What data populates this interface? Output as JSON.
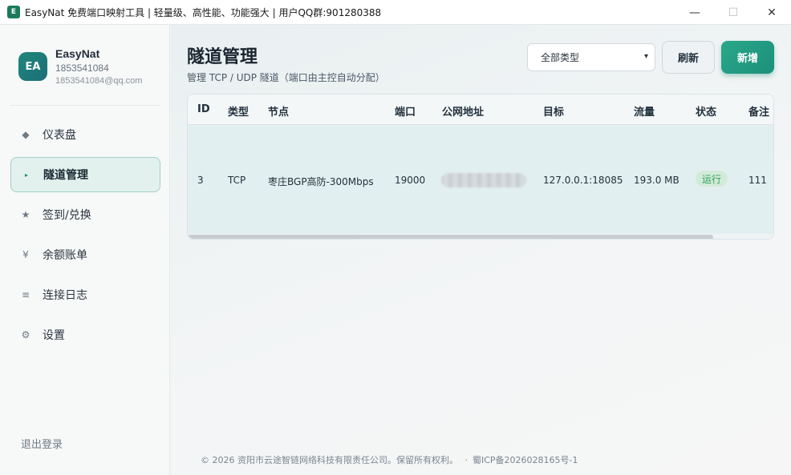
{
  "window": {
    "title": "EasyNat 免费端口映射工具 | 轻量级、高性能、功能强大 | 用户QQ群:901280388",
    "icon_text": "E",
    "controls": {
      "minimize": "—",
      "maximize": "☐",
      "close": "✕"
    }
  },
  "profile": {
    "avatar_initials": "EA",
    "name": "EasyNat",
    "id": "1853541084",
    "email": "1853541084@qq.com"
  },
  "sidebar": {
    "items": [
      {
        "label": "仪表盘",
        "icon": "diamond-icon",
        "glyph": "◆",
        "active": false
      },
      {
        "label": "隧道管理",
        "icon": "play-icon",
        "glyph": "▸",
        "active": true
      },
      {
        "label": "签到/兑换",
        "icon": "star-icon",
        "glyph": "★",
        "active": false
      },
      {
        "label": "余额账单",
        "icon": "yen-icon",
        "glyph": "¥",
        "active": false
      },
      {
        "label": "连接日志",
        "icon": "list-icon",
        "glyph": "≡",
        "active": false
      },
      {
        "label": "设置",
        "icon": "gear-icon",
        "glyph": "⚙",
        "active": false
      }
    ],
    "logout_label": "退出登录"
  },
  "main": {
    "title": "隧道管理",
    "subtitle": "管理 TCP / UDP 隧道（端口由主控自动分配）",
    "type_filter": {
      "selected": "全部类型"
    },
    "refresh_label": "刷新",
    "add_label": "新增"
  },
  "table": {
    "columns": [
      "ID",
      "类型",
      "节点",
      "端口",
      "公网地址",
      "目标",
      "流量",
      "状态",
      "备注"
    ],
    "rows": [
      {
        "id": "3",
        "type": "TCP",
        "node": "枣庄BGP高防-300Mbps",
        "port": "19000",
        "public_address": "",
        "target": "127.0.0.1:18085",
        "traffic": "193.0 MB",
        "status": "运行",
        "note": "111"
      }
    ]
  },
  "footer": {
    "copyright": "© 2026 资阳市云途智链网络科技有限责任公司。保留所有权利。",
    "separator": "·",
    "icp": "蜀ICP备2026028165号-1"
  },
  "colors": {
    "accent": "#1c8f7a",
    "status_running_bg": "#d2ebd9",
    "status_running_text": "#2f9e5b"
  }
}
